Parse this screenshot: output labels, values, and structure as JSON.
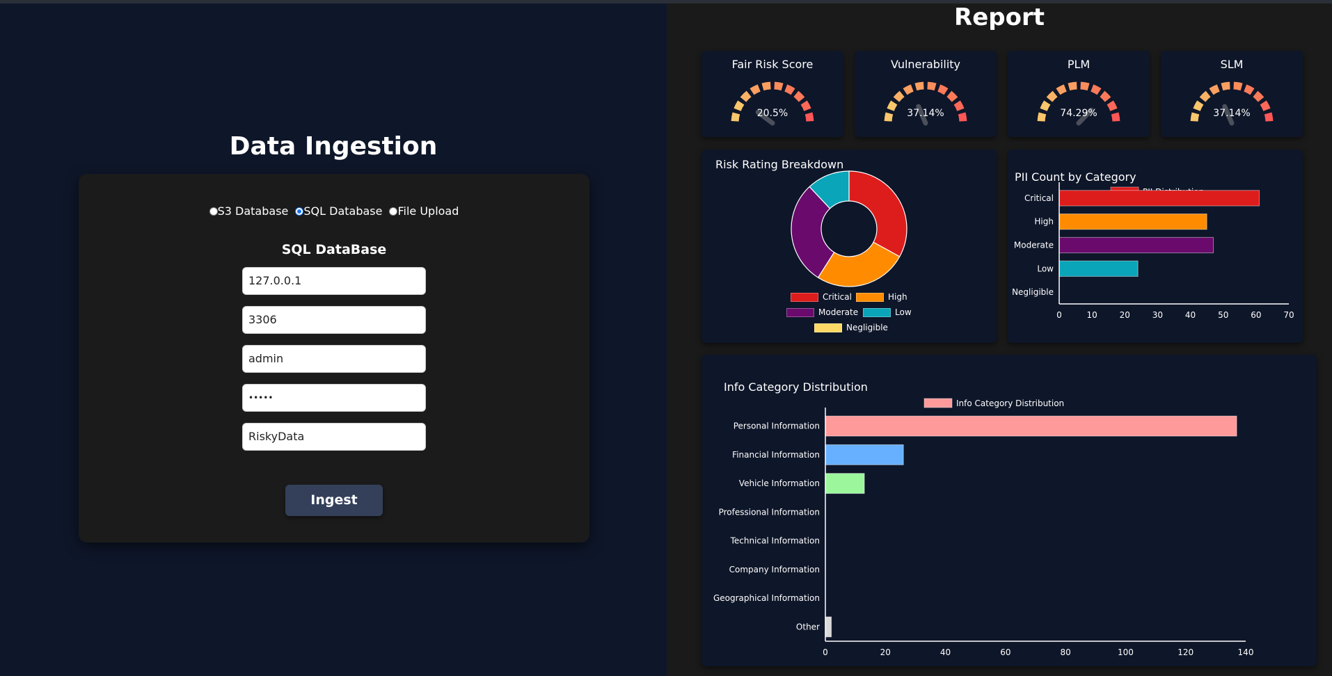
{
  "ingestion": {
    "title": "Data Ingestion",
    "sources": [
      {
        "label": "S3 Database",
        "selected": false
      },
      {
        "label": "SQL Database",
        "selected": true
      },
      {
        "label": "File Upload",
        "selected": false
      }
    ],
    "form_title": "SQL DataBase",
    "fields": [
      {
        "name": "host",
        "value": "127.0.0.1"
      },
      {
        "name": "port",
        "value": "3306"
      },
      {
        "name": "username",
        "value": "admin"
      },
      {
        "name": "password",
        "value": "•••••"
      },
      {
        "name": "database",
        "value": "RiskyData"
      }
    ],
    "ingest_label": "Ingest"
  },
  "report": {
    "title": "Report",
    "gauges": [
      {
        "label": "Fair Risk Score",
        "value_text": "20.5%",
        "value": 20.5
      },
      {
        "label": "Vulnerability",
        "value_text": "37.14%",
        "value": 37.14
      },
      {
        "label": "PLM",
        "value_text": "74.29%",
        "value": 74.29
      },
      {
        "label": "SLM",
        "value_text": "37.14%",
        "value": 37.14
      }
    ],
    "gauge_colors": [
      "#f8c66b",
      "#f9b265",
      "#fa9f60",
      "#fb8c5c",
      "#fc7a59",
      "#fd6858",
      "#fe5757"
    ]
  },
  "chart_data": [
    {
      "type": "pie",
      "title": "Risk Rating Breakdown",
      "categories": [
        "Critical",
        "High",
        "Moderate",
        "Low",
        "Negligible"
      ],
      "values": [
        33,
        26,
        29,
        12,
        0
      ],
      "colors": [
        "#dd1c1c",
        "#ff8c00",
        "#6a0a6d",
        "#0aa5b8",
        "#ffd966"
      ],
      "legend_position": "bottom"
    },
    {
      "type": "bar",
      "orientation": "horizontal",
      "title": "PII Count by Category",
      "categories": [
        "Critical",
        "High",
        "Moderate",
        "Low",
        "Negligible"
      ],
      "series": [
        {
          "name": "PII Distribution",
          "values": [
            61,
            45,
            47,
            24,
            0
          ]
        }
      ],
      "colors": [
        "#dd1c1c",
        "#ff8c00",
        "#6a0a6d",
        "#0aa5b8",
        "#ffd966"
      ],
      "xlim": [
        0,
        70
      ],
      "xticks": [
        0,
        10,
        20,
        30,
        40,
        50,
        60,
        70
      ],
      "legend_position": "top"
    },
    {
      "type": "bar",
      "orientation": "horizontal",
      "title": "Info Category Distribution",
      "categories": [
        "Personal Information",
        "Financial Information",
        "Vehicle Information",
        "Professional Information",
        "Technical Information",
        "Company Information",
        "Geographical Information",
        "Other"
      ],
      "series": [
        {
          "name": "Info Category Distribution",
          "values": [
            137,
            26,
            13,
            0,
            0,
            0,
            0,
            2
          ]
        }
      ],
      "colors": [
        "#ff9a9a",
        "#66b0ff",
        "#9cf79c",
        "#ffcc99",
        "#cccccc",
        "#cccccc",
        "#cccccc",
        "#d9d9d9"
      ],
      "xlim": [
        0,
        140
      ],
      "xticks": [
        0,
        20,
        40,
        60,
        80,
        100,
        120,
        140
      ],
      "legend_position": "top"
    }
  ]
}
